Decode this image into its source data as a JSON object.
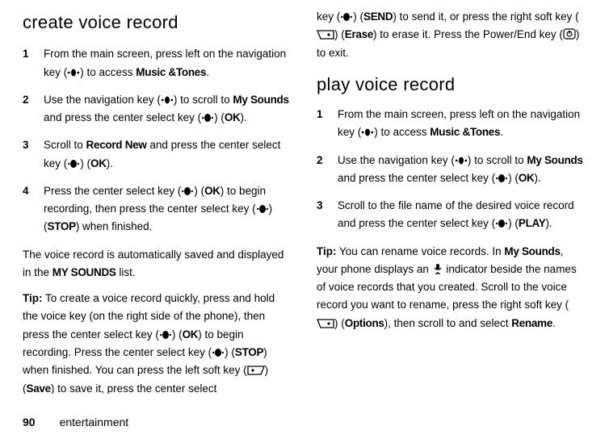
{
  "left": {
    "heading": "create voice record",
    "steps": [
      {
        "num": "1",
        "t1": "From the main screen, press left on the navigation key (",
        "t2": ") to access ",
        "b1": "Music &Tones",
        "t3": "."
      },
      {
        "num": "2",
        "t1": "Use the navigation key (",
        "t2": ") to scroll to ",
        "b1": "My Sounds",
        "t3": " and press the center select key (",
        "t4": ") (",
        "b2": "OK",
        "t5": ")."
      },
      {
        "num": "3",
        "t1": "Scroll to ",
        "b1": "Record New",
        "t2": " and press the center select key (",
        "t3": ") (",
        "b2": "OK",
        "t4": ")."
      },
      {
        "num": "4",
        "t1": "Press the center select key (",
        "t2": ") (",
        "b1": "OK",
        "t3": ") to begin recording, then press the center select key (",
        "t4": ") (",
        "b2": "STOP",
        "t5": ") when finished."
      }
    ],
    "auto1": "The voice record is automatically saved and displayed in the ",
    "auto_b": "MY SOUNDS",
    "auto2": " list.",
    "tip_lead": "Tip:",
    "tip_t1": " To create a voice record quickly, press and hold the voice key (on the right side of the phone), then press the center select key (",
    "tip_t2": ") (",
    "tip_b1": "OK",
    "tip_t3": ") to begin recording. Press the center select key (",
    "tip_t4": ") (",
    "tip_b2": "STOP",
    "tip_t5": ") when finished. You can press the left soft key (",
    "tip_t6": ") (",
    "tip_b3": "Save",
    "tip_t7": ") to save it, press the center select "
  },
  "right": {
    "cont_t1": "key (",
    "cont_t2": ") (",
    "cont_b1": "SEND",
    "cont_t3": ") to send it, or press the right soft key (",
    "cont_t4": ") (",
    "cont_b2": "Erase",
    "cont_t5": ") to erase it. Press the Power/End key (",
    "cont_t6": ") to exit.",
    "heading": "play voice record",
    "steps": [
      {
        "num": "1",
        "t1": "From the main screen, press left on the navigation key (",
        "t2": ") to access ",
        "b1": "Music &Tones",
        "t3": "."
      },
      {
        "num": "2",
        "t1": "Use the navigation key (",
        "t2": ") to scroll to ",
        "b1": "My Sounds",
        "t3": " and press the center select key (",
        "t4": ") (",
        "b2": "OK",
        "t5": ")."
      },
      {
        "num": "3",
        "t1": "Scroll to the file name of the desired voice record and press the center select key (",
        "t2": ") (",
        "b1": "PLAY",
        "t3": ")."
      }
    ],
    "tip_lead": "Tip:",
    "tip_t1": " You can rename voice records. In ",
    "tip_b1": "My Sounds",
    "tip_t2": ", your phone displays an ",
    "tip_t3": " indicator beside the names of voice records that you created. Scroll to the voice record you want to rename, press the right soft key (",
    "tip_t4": ") (",
    "tip_b2": "Options",
    "tip_t5": "), then scroll to and select ",
    "tip_b3": "Rename",
    "tip_t6": "."
  },
  "footer": {
    "page": "90",
    "section": "entertainment"
  }
}
